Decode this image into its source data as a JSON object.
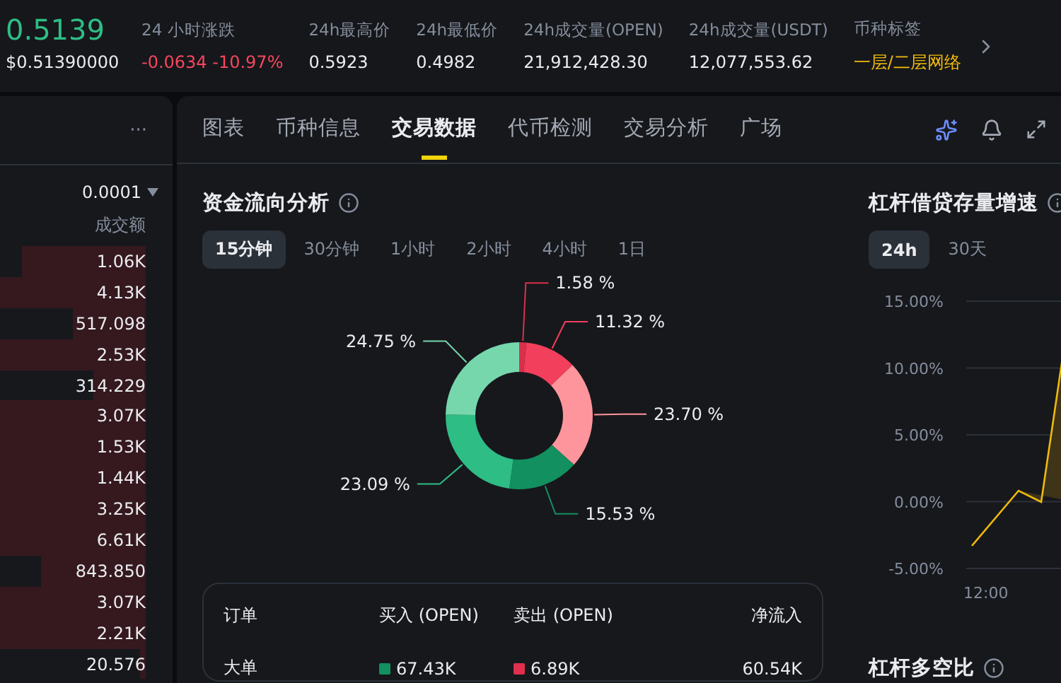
{
  "ticker": {
    "price": "0.5139",
    "price_usd": "$0.51390000",
    "stats": [
      {
        "label": "24 小时涨跌",
        "value": "-0.0634 -10.97%",
        "kind": "down"
      },
      {
        "label": "24h最高价",
        "value": "0.5923",
        "kind": "plain"
      },
      {
        "label": "24h最低价",
        "value": "0.4982",
        "kind": "plain"
      },
      {
        "label": "24h成交量(OPEN)",
        "value": "21,912,428.30",
        "kind": "plain"
      },
      {
        "label": "24h成交量(USDT)",
        "value": "12,077,553.62",
        "kind": "plain"
      },
      {
        "label": "币种标签",
        "value": "一层/二层网络",
        "kind": "tag"
      }
    ]
  },
  "order_book": {
    "more": "···",
    "precision": "0.0001",
    "column": "成交额",
    "rows": [
      {
        "amount": "1.06K"
      },
      {
        "amount": "4.13K"
      },
      {
        "amount": "517.098"
      },
      {
        "amount": "2.53K"
      },
      {
        "amount": "314.229"
      },
      {
        "amount": "3.07K"
      },
      {
        "amount": "1.53K"
      },
      {
        "amount": "1.44K"
      },
      {
        "amount": "3.25K"
      },
      {
        "amount": "6.61K"
      },
      {
        "amount": "843.850"
      },
      {
        "amount": "3.07K"
      },
      {
        "amount": "2.21K"
      },
      {
        "amount": "20.576"
      }
    ]
  },
  "tabs": [
    {
      "label": "图表",
      "selected": false
    },
    {
      "label": "币种信息",
      "selected": false
    },
    {
      "label": "交易数据",
      "selected": true
    },
    {
      "label": "代币检测",
      "selected": false
    },
    {
      "label": "交易分析",
      "selected": false
    },
    {
      "label": "广场",
      "selected": false
    }
  ],
  "fund_flow": {
    "title": "资金流向分析",
    "periods": [
      {
        "label": "15分钟",
        "selected": true
      },
      {
        "label": "30分钟",
        "selected": false
      },
      {
        "label": "1小时",
        "selected": false
      },
      {
        "label": "2小时",
        "selected": false
      },
      {
        "label": "4小时",
        "selected": false
      },
      {
        "label": "1日",
        "selected": false
      }
    ],
    "chart_data": {
      "type": "donut",
      "data_labels": true,
      "values": [
        1.58,
        11.32,
        23.7,
        15.53,
        23.09,
        24.75
      ],
      "value_labels": [
        "1.58 %",
        "11.32 %",
        "23.70 %",
        "15.53 %",
        "23.09 %",
        "24.75 %"
      ],
      "colors": [
        "#d9304a",
        "#f23f5c",
        "#ff959c",
        "#12905f",
        "#2ebd85",
        "#76d7ad"
      ]
    },
    "table": {
      "columns": [
        "订单",
        "买入 (OPEN)",
        "卖出 (OPEN)",
        "净流入"
      ],
      "rows": [
        {
          "order": "大单",
          "buy": "67.43K",
          "sell": "6.89K",
          "net": "60.54K"
        }
      ]
    }
  },
  "leverage": {
    "title": "杠杆借贷存量增速",
    "periods": [
      {
        "label": "24h",
        "selected": true
      },
      {
        "label": "30天",
        "selected": false
      }
    ],
    "y_labels": [
      "15.00%",
      "10.00%",
      "5.00%",
      "0.00%",
      "-5.00%"
    ],
    "x_labels": [
      "12:00"
    ],
    "next_title": "杠杆多空比"
  }
}
